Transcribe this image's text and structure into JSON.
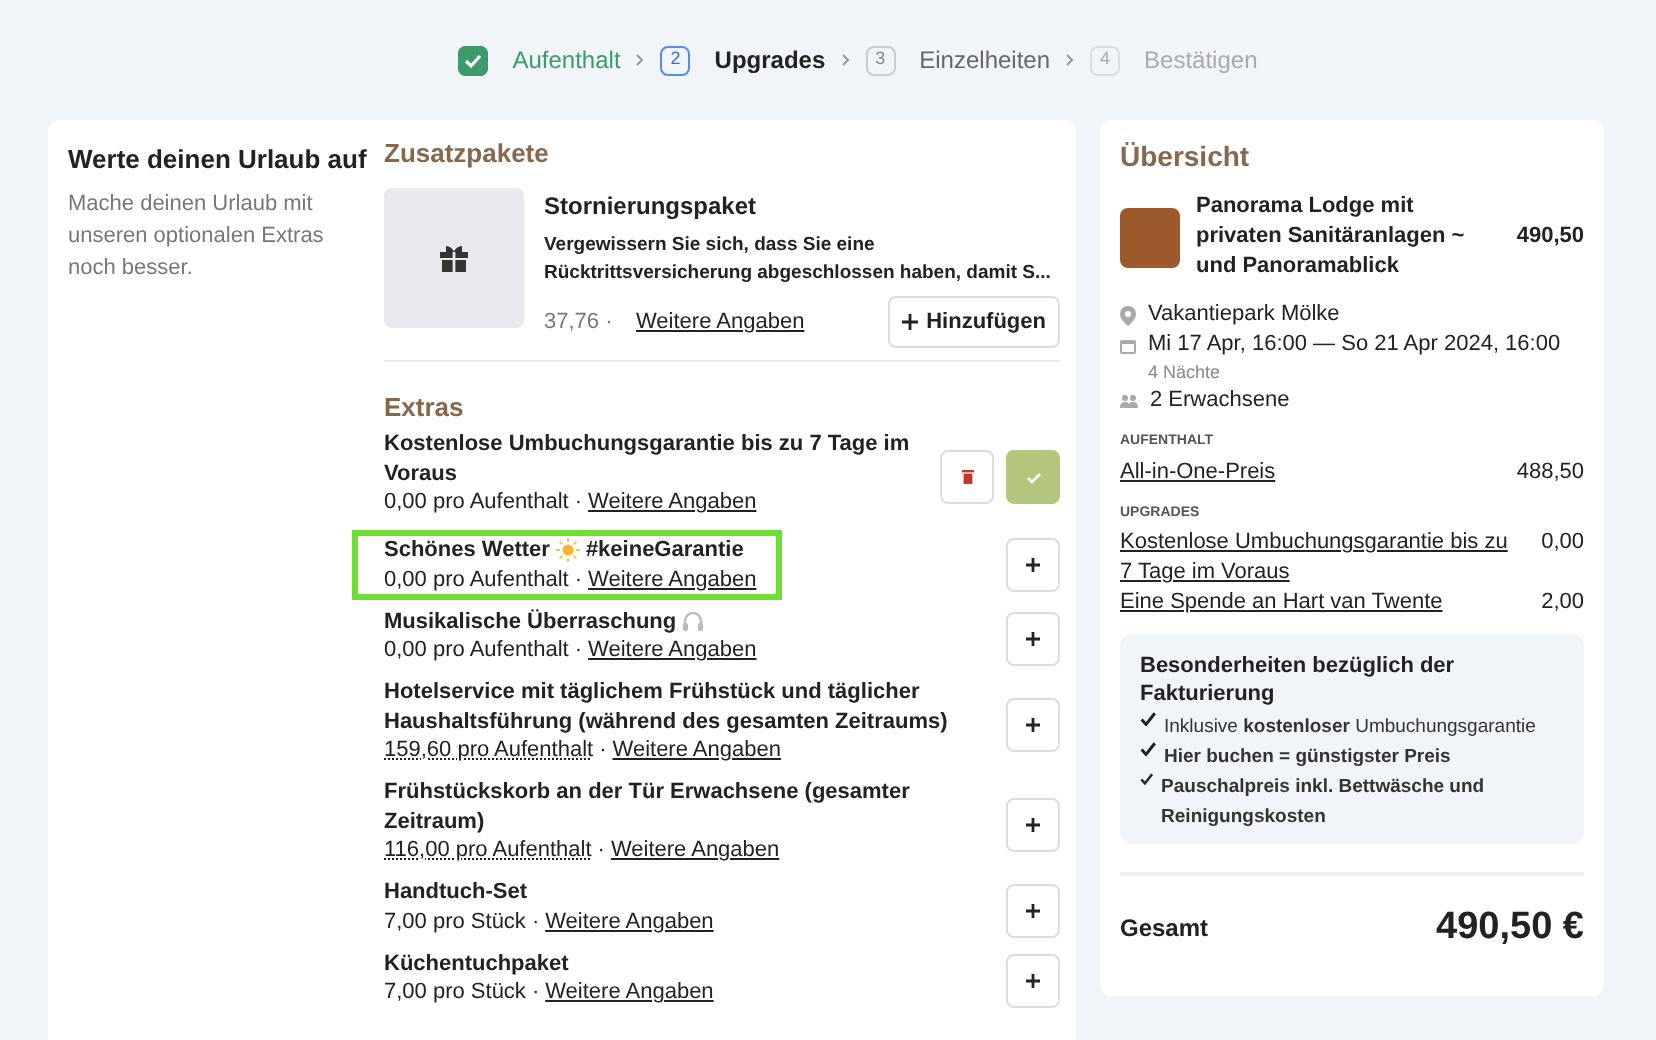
{
  "steps": [
    {
      "label": "Aufenthalt",
      "done": true,
      "selected": false,
      "disabled": false
    },
    {
      "number": "2",
      "label": "Upgrades",
      "done": false,
      "selected": true,
      "disabled": false
    },
    {
      "number": "3",
      "label": "Einzelheiten",
      "done": false,
      "selected": false,
      "disabled": false
    },
    {
      "number": "4",
      "label": "Bestätigen",
      "done": false,
      "selected": false,
      "disabled": true
    }
  ],
  "intro": {
    "title": "Werte deinen Urlaub auf",
    "text": "Mache deinen Urlaub mit unseren optionalen Extras noch besser."
  },
  "packages": {
    "heading": "Zusatzpakete",
    "items": [
      {
        "title": "Stornierungspaket",
        "description": "Vergewissern Sie sich, dass Sie eine Rücktrittsversicherung abgeschlossen haben, damit S...",
        "price": "37,76 ·",
        "link": "Weitere Angaben",
        "button": "Hinzufügen"
      }
    ]
  },
  "extras": {
    "heading": "Extras",
    "items": [
      {
        "name": "Kostenlose Umbuchungsgarantie bis zu 7 Tage im Voraus",
        "kind": "plain",
        "price": "0,00 pro Aufenthalt",
        "price_dotted": false,
        "separator": "·",
        "link": "Weitere Angaben",
        "added": true,
        "highlighted": false
      },
      {
        "name": "Schönes Wetter",
        "suffix": "#keineGarantie",
        "kind": "sun",
        "price": "0,00 pro Aufenthalt",
        "price_dotted": false,
        "separator": "·",
        "link": "Weitere Angaben",
        "added": false,
        "highlighted": true
      },
      {
        "name": "Musikalische Überraschung",
        "kind": "music",
        "price": "0,00 pro Aufenthalt",
        "price_dotted": false,
        "separator": "·",
        "link": "Weitere Angaben",
        "added": false,
        "highlighted": false
      },
      {
        "name": "Hotelservice mit täglichem Frühstück und täglicher Haushaltsführung (während des gesamten Zeitraums)",
        "kind": "plain",
        "price": "159,60 pro Aufenthalt",
        "price_dotted": true,
        "separator": "·",
        "link": "Weitere Angaben",
        "added": false,
        "highlighted": false
      },
      {
        "name": "Frühstückskorb an der Tür Erwachsene (gesamter Zeitraum)",
        "kind": "plain",
        "price": "116,00 pro Aufenthalt",
        "price_dotted": true,
        "separator": "·",
        "link": "Weitere Angaben",
        "added": false,
        "highlighted": false
      },
      {
        "name": "Handtuch-Set",
        "kind": "plain",
        "price": "7,00 pro Stück",
        "price_dotted": false,
        "separator": "·",
        "link": "Weitere Angaben",
        "added": false,
        "highlighted": false
      },
      {
        "name": "Küchentuchpaket",
        "kind": "plain",
        "price": "7,00 pro Stück",
        "price_dotted": false,
        "separator": "·",
        "link": "Weitere Angaben",
        "added": false,
        "highlighted": false
      }
    ]
  },
  "summary": {
    "heading": "Übersicht",
    "accommodation": {
      "name": "Panorama Lodge mit privaten Sanitäranlagen ~ und Panoramablick",
      "price": "490,50"
    },
    "location": "Vakantiepark Mölke",
    "dates": "Mi 17 Apr, 16:00 — So 21 Apr 2024, 16:00",
    "nights": "4 Nächte",
    "guests": "2 Erwachsene",
    "sections": [
      {
        "label": "AUFENTHALT",
        "lines": [
          {
            "name": "All-in-One-Preis",
            "amount": "488,50"
          }
        ]
      },
      {
        "label": "UPGRADES",
        "lines": [
          {
            "name": "Kostenlose Umbuchungsgarantie bis zu 7 Tage im Voraus",
            "amount": "0,00"
          },
          {
            "name": "Eine Spende an Hart van Twente",
            "amount": "2,00"
          }
        ]
      }
    ],
    "notes": {
      "title": "Besonderheiten bezüglich der Fakturierung",
      "items": [
        {
          "text": "Inklusive **kostenloser** Umbuchungsgarantie"
        },
        {
          "text": "**Hier buchen = günstigster Preis**"
        },
        {
          "text": "**Pauschalpreis inkl. Bettwäsche und Reinigungskosten**"
        }
      ]
    },
    "total_label": "Gesamt",
    "total": "490,50 €"
  }
}
